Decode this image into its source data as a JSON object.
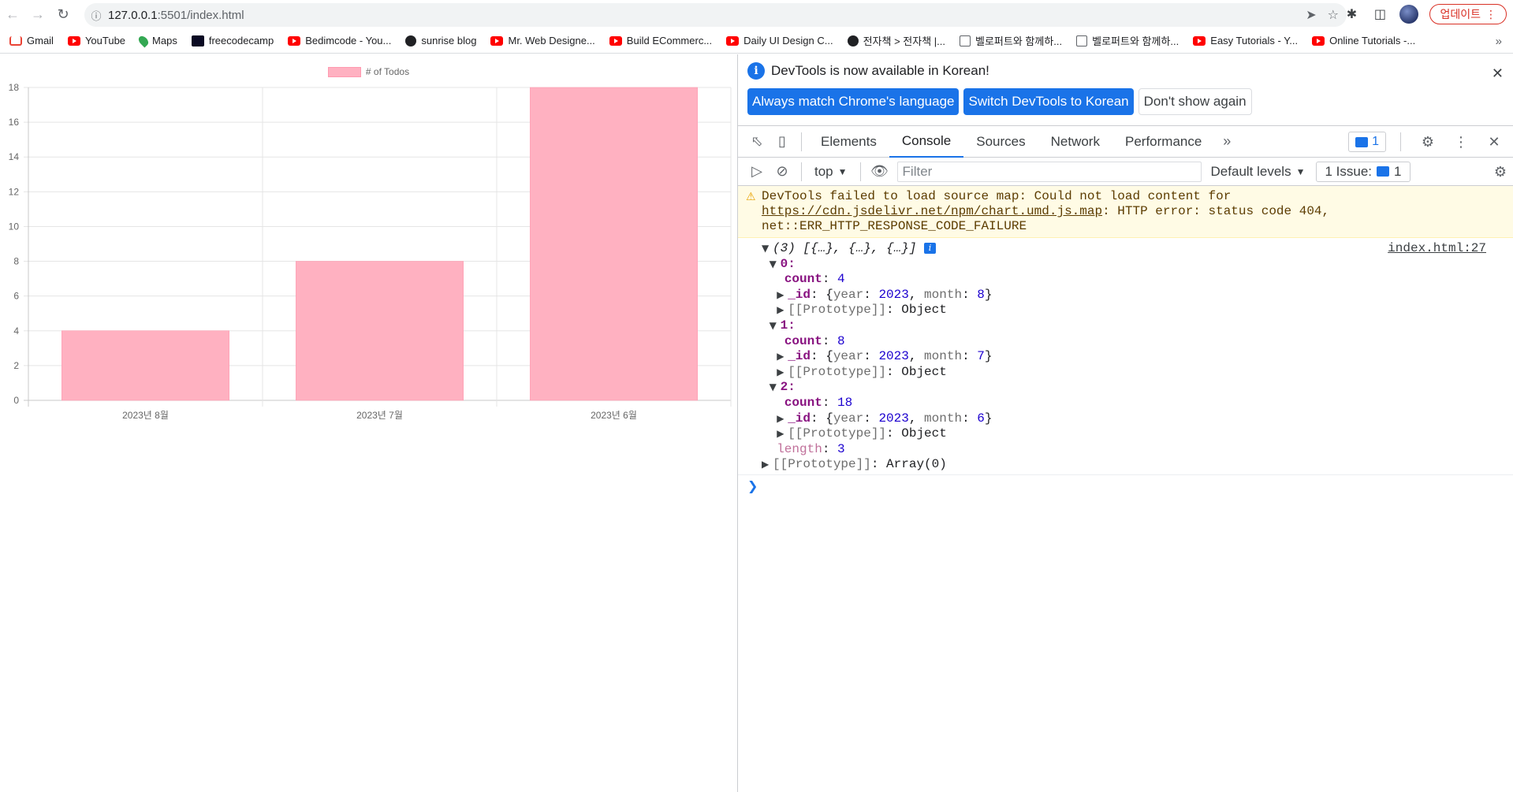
{
  "browser": {
    "url_host": "127.0.0.1",
    "url_path": ":5501/index.html",
    "update_label": "업데이트",
    "bookmarks": [
      {
        "label": "Gmail",
        "icon": "gmail-icon"
      },
      {
        "label": "YouTube",
        "icon": "youtube-icon"
      },
      {
        "label": "Maps",
        "icon": "maps-icon"
      },
      {
        "label": "freecodecamp",
        "icon": "freecodecamp-icon"
      },
      {
        "label": "Bedimcode - You...",
        "icon": "youtube-icon"
      },
      {
        "label": "sunrise blog",
        "icon": "globe-icon"
      },
      {
        "label": "Mr. Web Designe...",
        "icon": "youtube-icon"
      },
      {
        "label": "Build ECommerc...",
        "icon": "youtube-icon"
      },
      {
        "label": "Daily UI Design C...",
        "icon": "youtube-icon"
      },
      {
        "label": "전자책 > 전자책 |...",
        "icon": "globe-icon"
      },
      {
        "label": "벨로퍼트와 함께하...",
        "icon": "book-icon"
      },
      {
        "label": "벨로퍼트와 함께하...",
        "icon": "book-icon"
      },
      {
        "label": "Easy Tutorials - Y...",
        "icon": "youtube-icon"
      },
      {
        "label": "Online Tutorials -...",
        "icon": "youtube-icon"
      }
    ]
  },
  "chart_data": {
    "type": "bar",
    "categories": [
      "2023년 8월",
      "2023년 7월",
      "2023년 6월"
    ],
    "series": [
      {
        "name": "# of Todos",
        "values": [
          4,
          8,
          18
        ]
      }
    ],
    "ylim": [
      0,
      18
    ],
    "yticks": [
      0,
      2,
      4,
      6,
      8,
      10,
      12,
      14,
      16,
      18
    ],
    "grid": true,
    "legend": "top-center",
    "bar_color": "#ffb1c1"
  },
  "devtools": {
    "banner": {
      "message": "DevTools is now available in Korean!",
      "btn_match": "Always match Chrome's language",
      "btn_switch": "Switch DevTools to Korean",
      "btn_dismiss": "Don't show again"
    },
    "tabs": [
      "Elements",
      "Console",
      "Sources",
      "Network",
      "Performance"
    ],
    "active_tab": "Console",
    "issue_badge_count": "1",
    "context": "top",
    "filter_placeholder": "Filter",
    "levels": "Default levels",
    "issues_label": "1 Issue:",
    "issues_count": "1",
    "warning": {
      "prefix": "DevTools failed to load source map: Could not load content for ",
      "link": "https://cdn.jsdelivr.net/npm/chart.umd.js.map",
      "suffix": ": HTTP error: status code 404, net::ERR_HTTP_RESPONSE_CODE_FAILURE"
    },
    "log": {
      "summary": "(3) [{…}, {…}, {…}]",
      "source": "index.html:27",
      "items": [
        {
          "index": "0:",
          "count": "4",
          "year": "2023",
          "month": "8"
        },
        {
          "index": "1:",
          "count": "8",
          "year": "2023",
          "month": "7"
        },
        {
          "index": "2:",
          "count": "18",
          "year": "2023",
          "month": "6"
        }
      ],
      "length": "3",
      "array_proto": "Array(0)"
    }
  }
}
